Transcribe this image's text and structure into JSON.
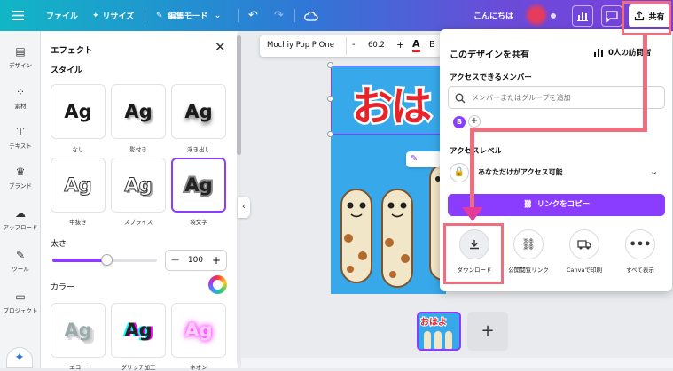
{
  "topbar": {
    "menu_icon": "menu-icon",
    "file_label": "ファイル",
    "resize_label": "リサイズ",
    "edit_mode_label": "編集モード",
    "greeting": "こんにちは",
    "share_label": "共有"
  },
  "rail": {
    "items": [
      {
        "label": "デザイン",
        "icon": "layout-icon"
      },
      {
        "label": "素材",
        "icon": "elements-icon"
      },
      {
        "label": "テキスト",
        "icon": "text-icon"
      },
      {
        "label": "ブランド",
        "icon": "brand-icon"
      },
      {
        "label": "アップロード",
        "icon": "upload-icon"
      },
      {
        "label": "ツール",
        "icon": "draw-icon"
      },
      {
        "label": "プロジェクト",
        "icon": "folder-icon"
      }
    ]
  },
  "effects": {
    "title": "エフェクト",
    "style_section": "スタイル",
    "styles": [
      {
        "sample": "Ag",
        "label": "なし"
      },
      {
        "sample": "Ag",
        "label": "影付き"
      },
      {
        "sample": "Ag",
        "label": "浮き出し"
      },
      {
        "sample": "Ag",
        "label": "中抜き"
      },
      {
        "sample": "Ag",
        "label": "スプライス"
      },
      {
        "sample": "Ag",
        "label": "袋文字"
      }
    ],
    "selected_style": "袋文字",
    "thickness_label": "太さ",
    "thickness_value": "100",
    "thickness_fraction": 0.52,
    "minus": "—",
    "plus": "+",
    "color_section": "カラー",
    "more_styles": [
      {
        "sample": "Ag",
        "label": "エコー"
      },
      {
        "sample": "Ag",
        "label": "グリッチ加工"
      },
      {
        "sample": "Ag",
        "label": "ネオン"
      }
    ]
  },
  "text_toolbar": {
    "font": "Mochiy Pop P One",
    "minus": "-",
    "size": "60.2",
    "plus": "+",
    "color_letter": "A"
  },
  "design": {
    "headline": "おは"
  },
  "page_thumb": {
    "headline": "おはよ"
  },
  "add_page": "+",
  "share_panel": {
    "title": "このデザインを共有",
    "visitors": "0人の訪問者",
    "members_label": "アクセスできるメンバー",
    "search_placeholder": "メンバーまたはグループを追加",
    "avatar_letter": "B",
    "add": "+",
    "access_level_label": "アクセスレベル",
    "access_value": "あなただけがアクセス可能",
    "copy_link": "リンクをコピー",
    "options": [
      {
        "label": "ダウンロード",
        "icon": "download-icon"
      },
      {
        "label": "公開閲覧リンク",
        "icon": "link-icon"
      },
      {
        "label": "Canvaで印刷",
        "icon": "truck-icon"
      },
      {
        "label": "すべて表示",
        "icon": "more-icon"
      }
    ]
  },
  "colors": {
    "accent": "#8b3dff",
    "annotation": "#ee6e7e",
    "design_bg": "#37a9ea",
    "headline": "#e8232a"
  }
}
